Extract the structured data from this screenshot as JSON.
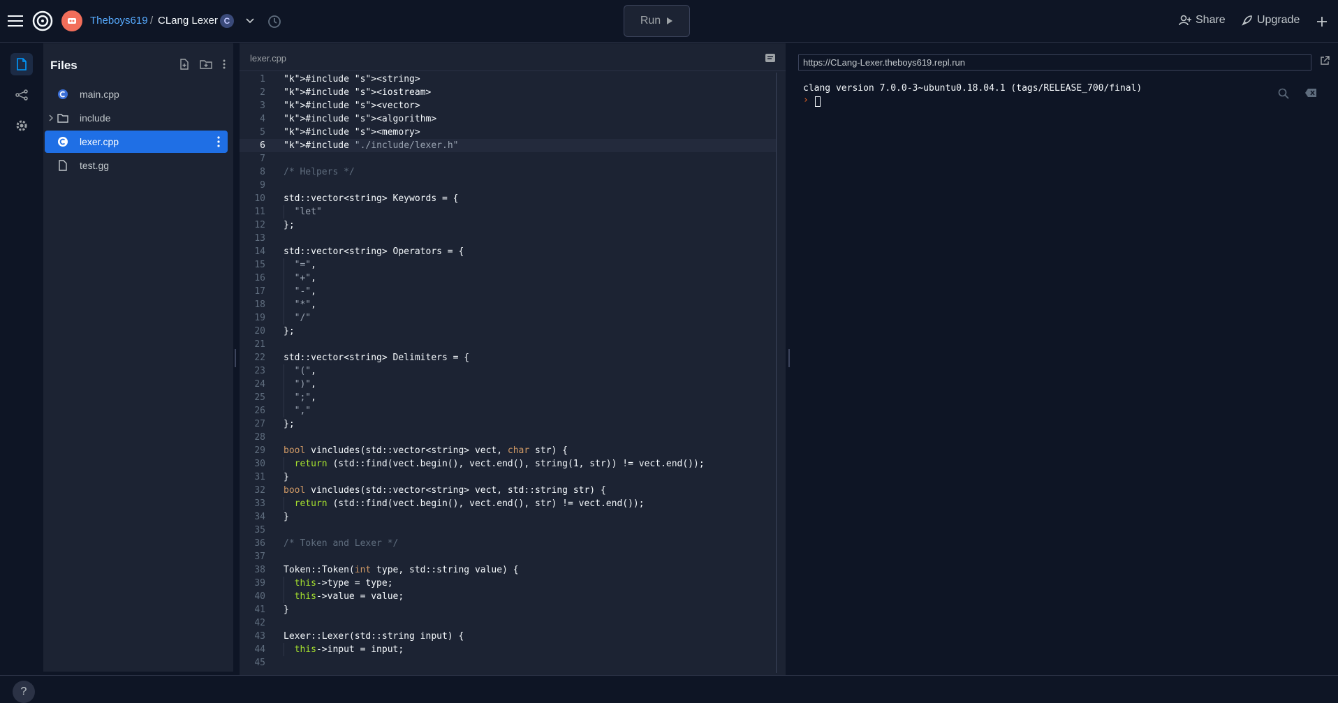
{
  "topbar": {
    "user": "Theboys619",
    "separator": "/",
    "repl_name": "CLang Lexer",
    "run_label": "Run",
    "share_label": "Share",
    "upgrade_label": "Upgrade"
  },
  "sidebar": {
    "title": "Files",
    "files": [
      {
        "name": "main.cpp",
        "type": "cpp"
      },
      {
        "name": "include",
        "type": "folder"
      },
      {
        "name": "lexer.cpp",
        "type": "cpp",
        "active": true
      },
      {
        "name": "test.gg",
        "type": "file"
      }
    ]
  },
  "editor": {
    "tab": "lexer.cpp",
    "current_line": 6,
    "lines": [
      "#include <string>",
      "#include <iostream>",
      "#include <vector>",
      "#include <algorithm>",
      "#include <memory>",
      "#include \"./include/lexer.h\"",
      "",
      "/* Helpers */",
      "",
      "std::vector<string> Keywords = {",
      "  \"let\"",
      "};",
      "",
      "std::vector<string> Operators = {",
      "  \"=\",",
      "  \"+\",",
      "  \"-\",",
      "  \"*\",",
      "  \"/\"",
      "};",
      "",
      "std::vector<string> Delimiters = {",
      "  \"(\",",
      "  \")\",",
      "  \";\",",
      "  \",\"",
      "};",
      "",
      "bool vincludes(std::vector<string> vect, char str) {",
      "  return (std::find(vect.begin(), vect.end(), string(1, str)) != vect.end());",
      "}",
      "bool vincludes(std::vector<string> vect, std::string str) {",
      "  return (std::find(vect.begin(), vect.end(), str) != vect.end());",
      "}",
      "",
      "/* Token and Lexer */",
      "",
      "Token::Token(int type, std::string value) {",
      "  this->type = type;",
      "  this->value = value;",
      "}",
      "",
      "Lexer::Lexer(std::string input) {",
      "  this->input = input;",
      ""
    ]
  },
  "console": {
    "url": "https://CLang-Lexer.theboys619.repl.run",
    "output": "clang version 7.0.0-3~ubuntu0.18.04.1 (tags/RELEASE_700/final)",
    "prompt": "›"
  },
  "help_label": "?",
  "colors": {
    "background": "#0e1525",
    "panel": "#1c2333",
    "accent": "#1f6fe5",
    "prompt": "#f26522",
    "avatar": "#f26e5a"
  }
}
